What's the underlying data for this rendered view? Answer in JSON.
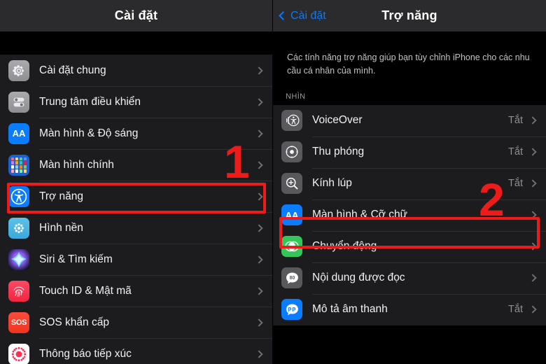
{
  "left_panel": {
    "navbar": {
      "title": "Cài đặt"
    },
    "items": [
      {
        "label": "Cài đặt chung",
        "icon": "gear-icon",
        "value": ""
      },
      {
        "label": "Trung tâm điều khiển",
        "icon": "control-center-icon",
        "value": ""
      },
      {
        "label": "Màn hình & Độ sáng",
        "icon": "display-aa-icon",
        "value": ""
      },
      {
        "label": "Màn hình chính",
        "icon": "home-screen-icon",
        "value": ""
      },
      {
        "label": "Trợ năng",
        "icon": "accessibility-icon",
        "value": ""
      },
      {
        "label": "Hình nền",
        "icon": "wallpaper-icon",
        "value": ""
      },
      {
        "label": "Siri & Tìm kiếm",
        "icon": "siri-icon",
        "value": ""
      },
      {
        "label": "Touch ID & Mật mã",
        "icon": "touch-id-icon",
        "value": ""
      },
      {
        "label": "SOS khẩn cấp",
        "icon": "sos-icon",
        "value": ""
      },
      {
        "label": "Thông báo tiếp xúc",
        "icon": "exposure-notification-icon",
        "value": ""
      }
    ]
  },
  "right_panel": {
    "navbar": {
      "back_label": "Cài đặt",
      "title": "Trợ năng"
    },
    "description": "Các tính năng trợ năng giúp bạn tùy chỉnh iPhone cho các nhu cầu cá nhân của mình.",
    "section_header": "NHÌN",
    "items": [
      {
        "label": "VoiceOver",
        "icon": "voiceover-icon",
        "value": "Tắt"
      },
      {
        "label": "Thu phóng",
        "icon": "zoom-icon",
        "value": "Tắt"
      },
      {
        "label": "Kính lúp",
        "icon": "magnifier-icon",
        "value": "Tắt"
      },
      {
        "label": "Màn hình & Cỡ chữ",
        "icon": "display-text-size-icon",
        "value": ""
      },
      {
        "label": "Chuyển động",
        "icon": "motion-icon",
        "value": ""
      },
      {
        "label": "Nội dung được đọc",
        "icon": "spoken-content-icon",
        "value": ""
      },
      {
        "label": "Mô tả âm thanh",
        "icon": "audio-description-icon",
        "value": "Tắt"
      }
    ]
  },
  "annotations": {
    "step_one": "1",
    "step_two": "2",
    "highlight_color": "#ee1b1b"
  }
}
